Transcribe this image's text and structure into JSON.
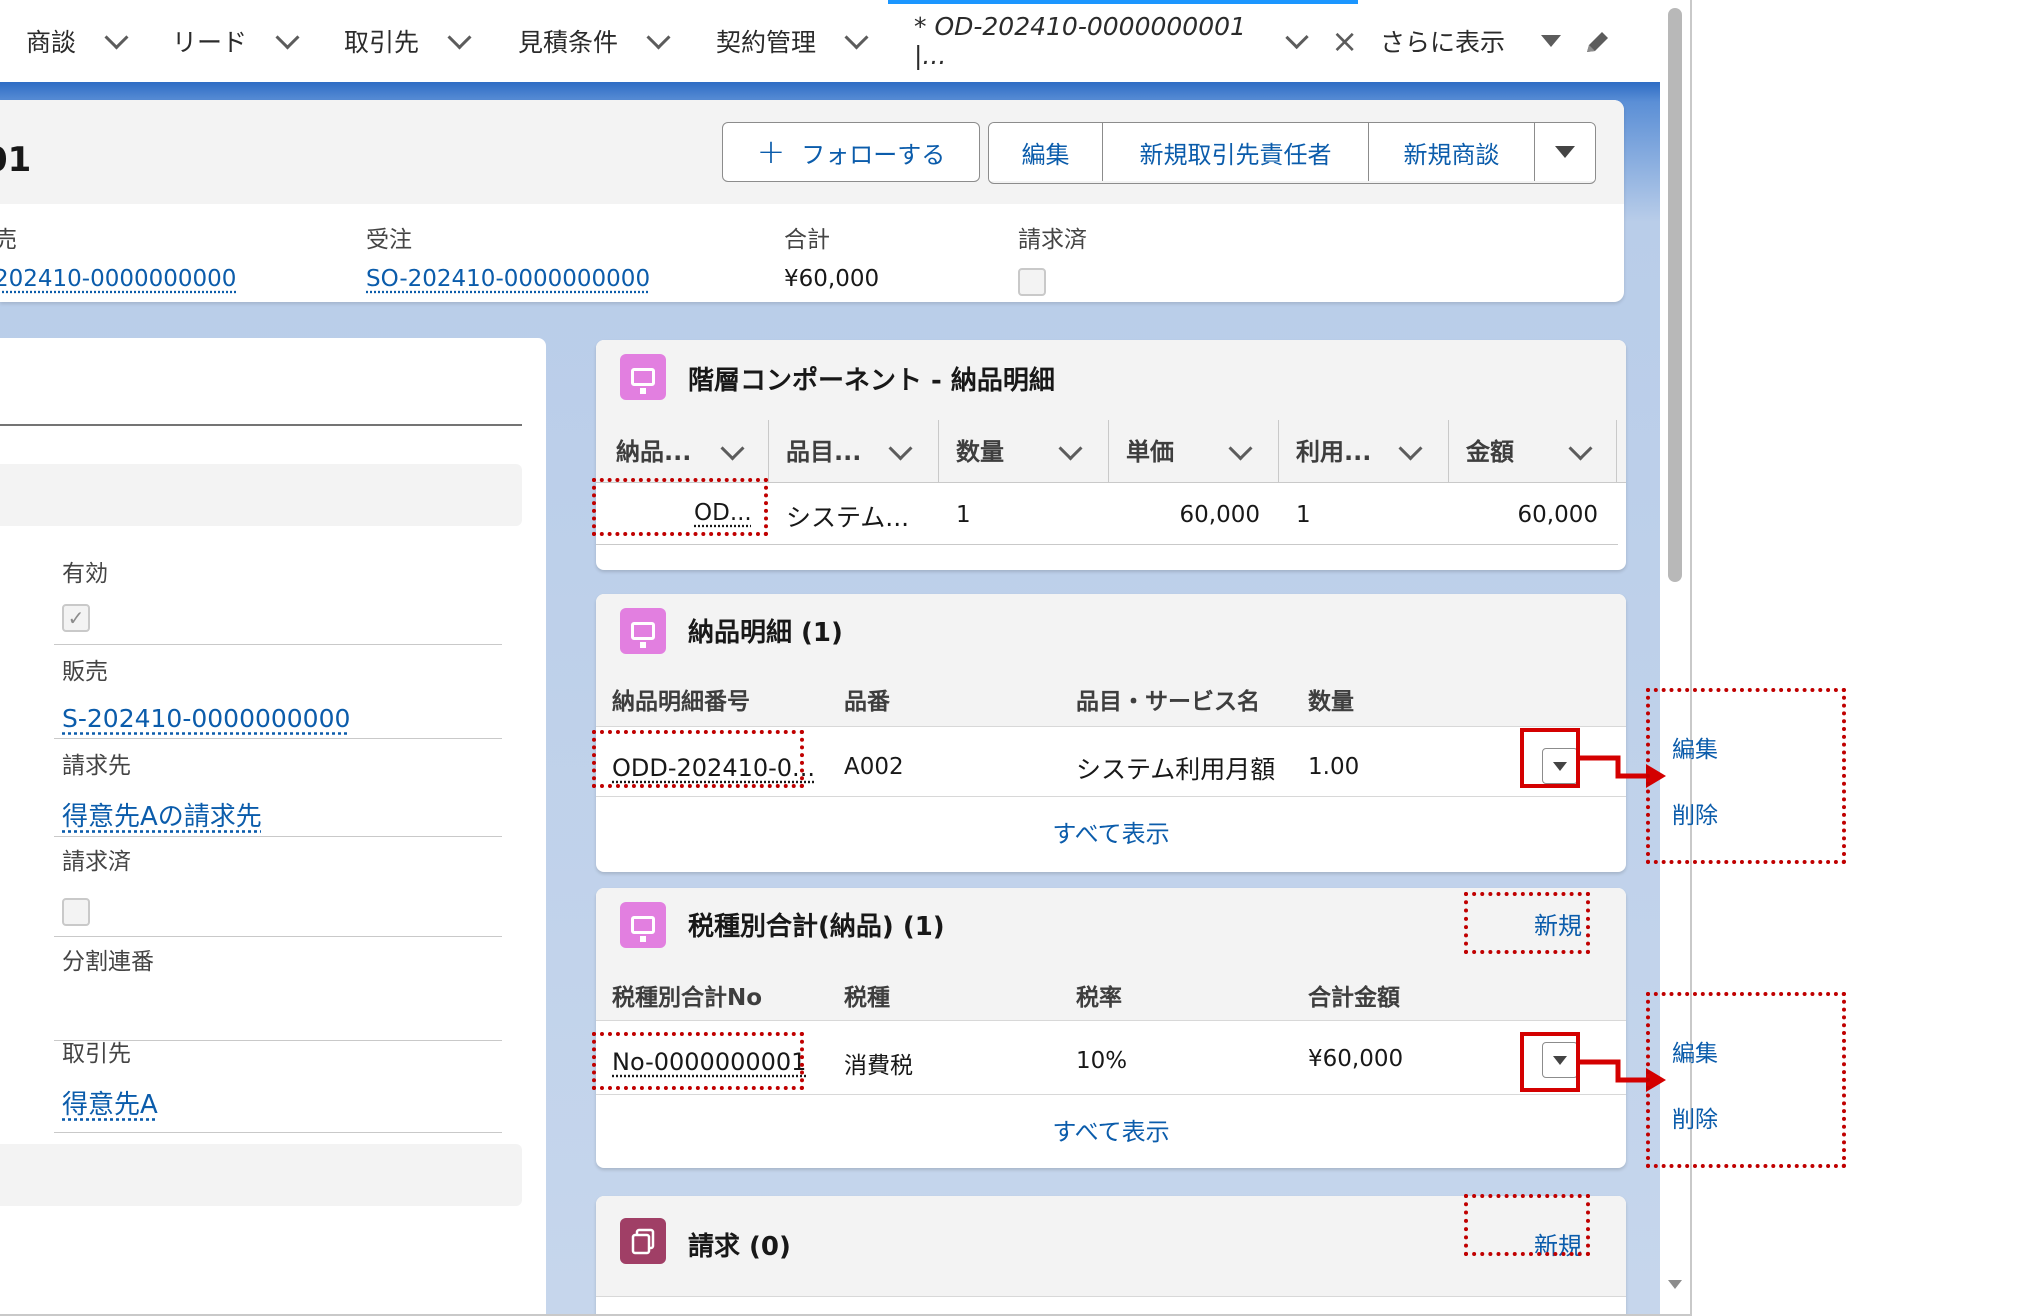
{
  "tabs": [
    {
      "label": "商談"
    },
    {
      "label": "リード"
    },
    {
      "label": "取引先"
    },
    {
      "label": "見積条件"
    },
    {
      "label": "契約管理"
    },
    {
      "label": "* OD-202410-0000000001 |..."
    },
    {
      "label": "さらに表示"
    }
  ],
  "header": {
    "title": "01",
    "follow_label": "フォローする",
    "actions": [
      "編集",
      "新規取引先責任者",
      "新規商談"
    ],
    "fields": [
      {
        "label": "売",
        "value": "202410-0000000000"
      },
      {
        "label": "受注",
        "value": "SO-202410-0000000000"
      },
      {
        "label": "合計",
        "value": "¥60,000"
      },
      {
        "label": "請求済",
        "value": ""
      }
    ]
  },
  "left": {
    "fields": [
      {
        "label": "有効",
        "value": ""
      },
      {
        "label": "販売",
        "value": "S-202410-0000000000"
      },
      {
        "label": "請求先",
        "value": "得意先Aの請求先"
      },
      {
        "label": "請求済",
        "value": ""
      },
      {
        "label": "分割連番",
        "value": ""
      },
      {
        "label": "取引先",
        "value": "得意先A"
      }
    ]
  },
  "hierarchy": {
    "title": "階層コンポーネント - 納品明細",
    "columns": [
      "納品...",
      "品目...",
      "数量",
      "単価",
      "利用...",
      "金額"
    ],
    "row": [
      "OD...",
      "システム...",
      "1",
      "60,000",
      "1",
      "60,000"
    ]
  },
  "delivery": {
    "title": "納品明細 (1)",
    "columns": [
      "納品明細番号",
      "品番",
      "品目・サービス名",
      "数量"
    ],
    "row": [
      "ODD-202410-0...",
      "A002",
      "システム利用月額",
      "1.00"
    ],
    "view_all": "すべて表示"
  },
  "tax": {
    "title": "税種別合計(納品) (1)",
    "new_label": "新規",
    "columns": [
      "税種別合計No",
      "税種",
      "税率",
      "合計金額"
    ],
    "row": [
      "No-0000000001",
      "消費税",
      "10%",
      "¥60,000"
    ],
    "view_all": "すべて表示"
  },
  "billing": {
    "title": "請求 (0)",
    "new_label": "新規"
  },
  "menu1": {
    "items": [
      "編集",
      "削除"
    ]
  },
  "menu2": {
    "items": [
      "編集",
      "削除"
    ]
  },
  "colors": {
    "accent": "#0b5cab",
    "annotation": "#c00000",
    "icon_pink": "#e27fe0"
  }
}
